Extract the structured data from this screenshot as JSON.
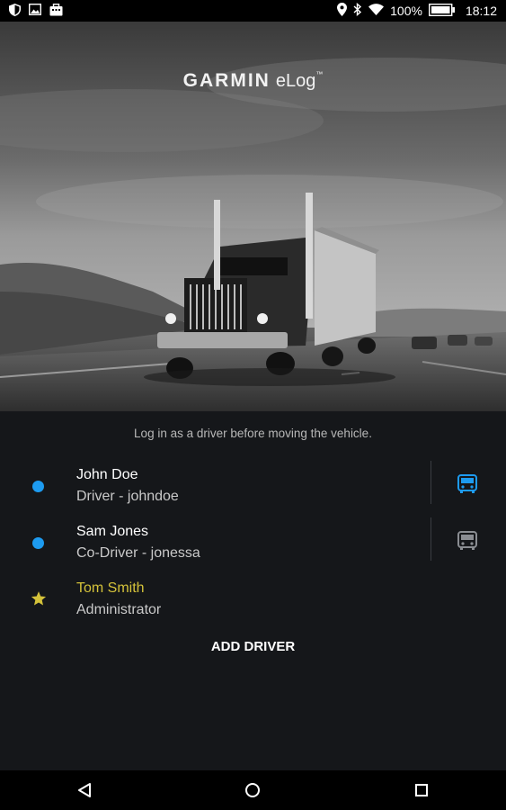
{
  "status_bar": {
    "battery_percent": "100%",
    "time": "18:12",
    "left_icons": [
      "shield-icon",
      "image-icon",
      "briefcase-icon"
    ],
    "right_icons": [
      "location-icon",
      "bluetooth-icon",
      "wifi-icon",
      "battery-icon"
    ]
  },
  "hero": {
    "brand": "GARMIN",
    "product": "eLog",
    "trademark": "™"
  },
  "notice": "Log in as a driver before moving the vehicle.",
  "drivers": [
    {
      "name": "John Doe",
      "role": "Driver - johndoe",
      "marker": "dot",
      "vehicle_icon_active": true
    },
    {
      "name": "Sam Jones",
      "role": "Co-Driver - jonessa",
      "marker": "dot",
      "vehicle_icon_active": false
    },
    {
      "name": "Tom Smith",
      "role": "Administrator",
      "marker": "star"
    }
  ],
  "add_driver_label": "ADD DRIVER",
  "colors": {
    "accent_blue": "#1d9bf0",
    "admin_gold": "#d4c23a",
    "inactive_icon": "#8a8d92",
    "background": "#15171a"
  },
  "nav": [
    "back-icon",
    "home-icon",
    "recents-icon"
  ]
}
